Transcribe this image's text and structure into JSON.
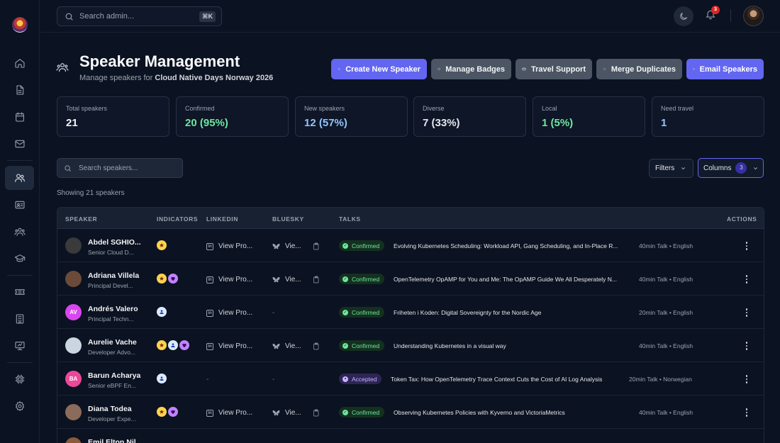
{
  "topbar": {
    "search_placeholder": "Search admin...",
    "search_shortcut": "⌘K",
    "notification_count": "3"
  },
  "header": {
    "title": "Speaker Management",
    "subtitle_prefix": "Manage speakers for ",
    "event_name": "Cloud Native Days Norway 2026"
  },
  "actions": [
    {
      "label": "Create New Speaker",
      "icon": "plus-icon",
      "style": "primary"
    },
    {
      "label": "Manage Badges",
      "icon": "badge-icon",
      "style": "gray"
    },
    {
      "label": "Travel Support",
      "icon": "card-icon",
      "style": "gray"
    },
    {
      "label": "Merge Duplicates",
      "icon": "merge-icon",
      "style": "gray"
    },
    {
      "label": "Email Speakers",
      "icon": "mail-icon",
      "style": "primary"
    }
  ],
  "stats": [
    {
      "label": "Total speakers",
      "value": "21",
      "color": "#f3f4f6"
    },
    {
      "label": "Confirmed",
      "value": "20 (95%)",
      "color": "#6ee7a0"
    },
    {
      "label": "New speakers",
      "value": "12 (57%)",
      "color": "#93c5fd"
    },
    {
      "label": "Diverse",
      "value": "7 (33%)",
      "color": "#e5e7eb"
    },
    {
      "label": "Local",
      "value": "1 (5%)",
      "color": "#6ee7a0"
    },
    {
      "label": "Need travel",
      "value": "1",
      "color": "#93c5fd"
    }
  ],
  "toolbar": {
    "search_placeholder": "Search speakers...",
    "filters_label": "Filters",
    "columns_label": "Columns",
    "columns_count": "3",
    "showing_text": "Showing 21 speakers"
  },
  "table": {
    "headers": [
      "SPEAKER",
      "INDICATORS",
      "LINKEDIN",
      "BLUESKY",
      "TALKS",
      "ACTIONS"
    ],
    "rows": [
      {
        "name": "Abdel SGHIO...",
        "title": "Senior Cloud D...",
        "initials": "",
        "avatar_color": "#3a3a3a",
        "indicators": [
          "star"
        ],
        "linkedin": "View Pro...",
        "bluesky": "Vie...",
        "status": "Confirmed",
        "talk": "Evolving Kubernetes Scheduling: Workload API, Gang Scheduling, and In-Place R...",
        "meta": "40min Talk • English"
      },
      {
        "name": "Adriana Villela",
        "title": "Principal Devel...",
        "initials": "",
        "avatar_color": "#6b4a3a",
        "indicators": [
          "star",
          "heart"
        ],
        "linkedin": "View Pro...",
        "bluesky": "Vie...",
        "status": "Confirmed",
        "talk": "OpenTelemetry OpAMP for You and Me: The OpAMP Guide We All Desperately N...",
        "meta": "40min Talk • English"
      },
      {
        "name": "Andrés Valero",
        "title": "Principal Techn...",
        "initials": "AV",
        "avatar_color": "#d946ef",
        "indicators": [
          "person"
        ],
        "linkedin": "View Pro...",
        "bluesky": "-",
        "status": "Confirmed",
        "talk": "Friheten i Koden: Digital Sovereignty for the Nordic Age",
        "meta": "20min Talk • English"
      },
      {
        "name": "Aurelie Vache",
        "title": "Developer Advo...",
        "initials": "",
        "avatar_color": "#cbd5e1",
        "indicators": [
          "star",
          "person",
          "heart"
        ],
        "linkedin": "View Pro...",
        "bluesky": "Vie...",
        "status": "Confirmed",
        "talk": "Understanding Kubernetes in a visual way",
        "meta": "40min Talk • English"
      },
      {
        "name": "Barun Acharya",
        "title": "Senior eBPF En...",
        "initials": "BA",
        "avatar_color": "#ec4899",
        "indicators": [
          "person"
        ],
        "linkedin": "-",
        "bluesky": "-",
        "status": "Accepted",
        "talk": "Token Tax: How OpenTelemetry Trace Context Cuts the Cost of AI Log Analysis",
        "meta": "20min Talk • Norwegian"
      },
      {
        "name": "Diana Todea",
        "title": "Developer Expe...",
        "initials": "",
        "avatar_color": "#8b6b5a",
        "indicators": [
          "star",
          "heart"
        ],
        "linkedin": "View Pro...",
        "bluesky": "Vie...",
        "status": "Confirmed",
        "talk": "Observing Kubernetes Policies with Kyverno and VictoriaMetrics",
        "meta": "40min Talk • English"
      },
      {
        "name": "Emil Elton Nil...",
        "title": "",
        "initials": "",
        "avatar_color": "#8b5a3a",
        "indicators": [],
        "linkedin": "",
        "bluesky": "",
        "status": "",
        "talk": "",
        "meta": ""
      }
    ]
  }
}
